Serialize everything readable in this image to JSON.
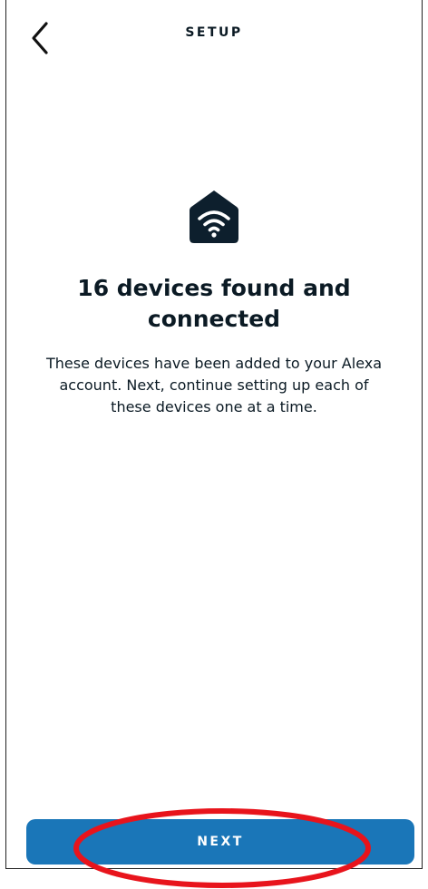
{
  "header": {
    "title": "SETUP",
    "back_icon": "chevron-left-icon"
  },
  "hero": {
    "icon": "home-wifi-icon"
  },
  "content": {
    "headline": "16 devices found and connected",
    "body": "These devices have been added to your Alexa account. Next, continue setting up each of these devices one at a time."
  },
  "footer": {
    "next_label": "NEXT"
  },
  "colors": {
    "primary_button": "#1a76b8",
    "text": "#0b1a24",
    "annotation": "#e8141c"
  }
}
